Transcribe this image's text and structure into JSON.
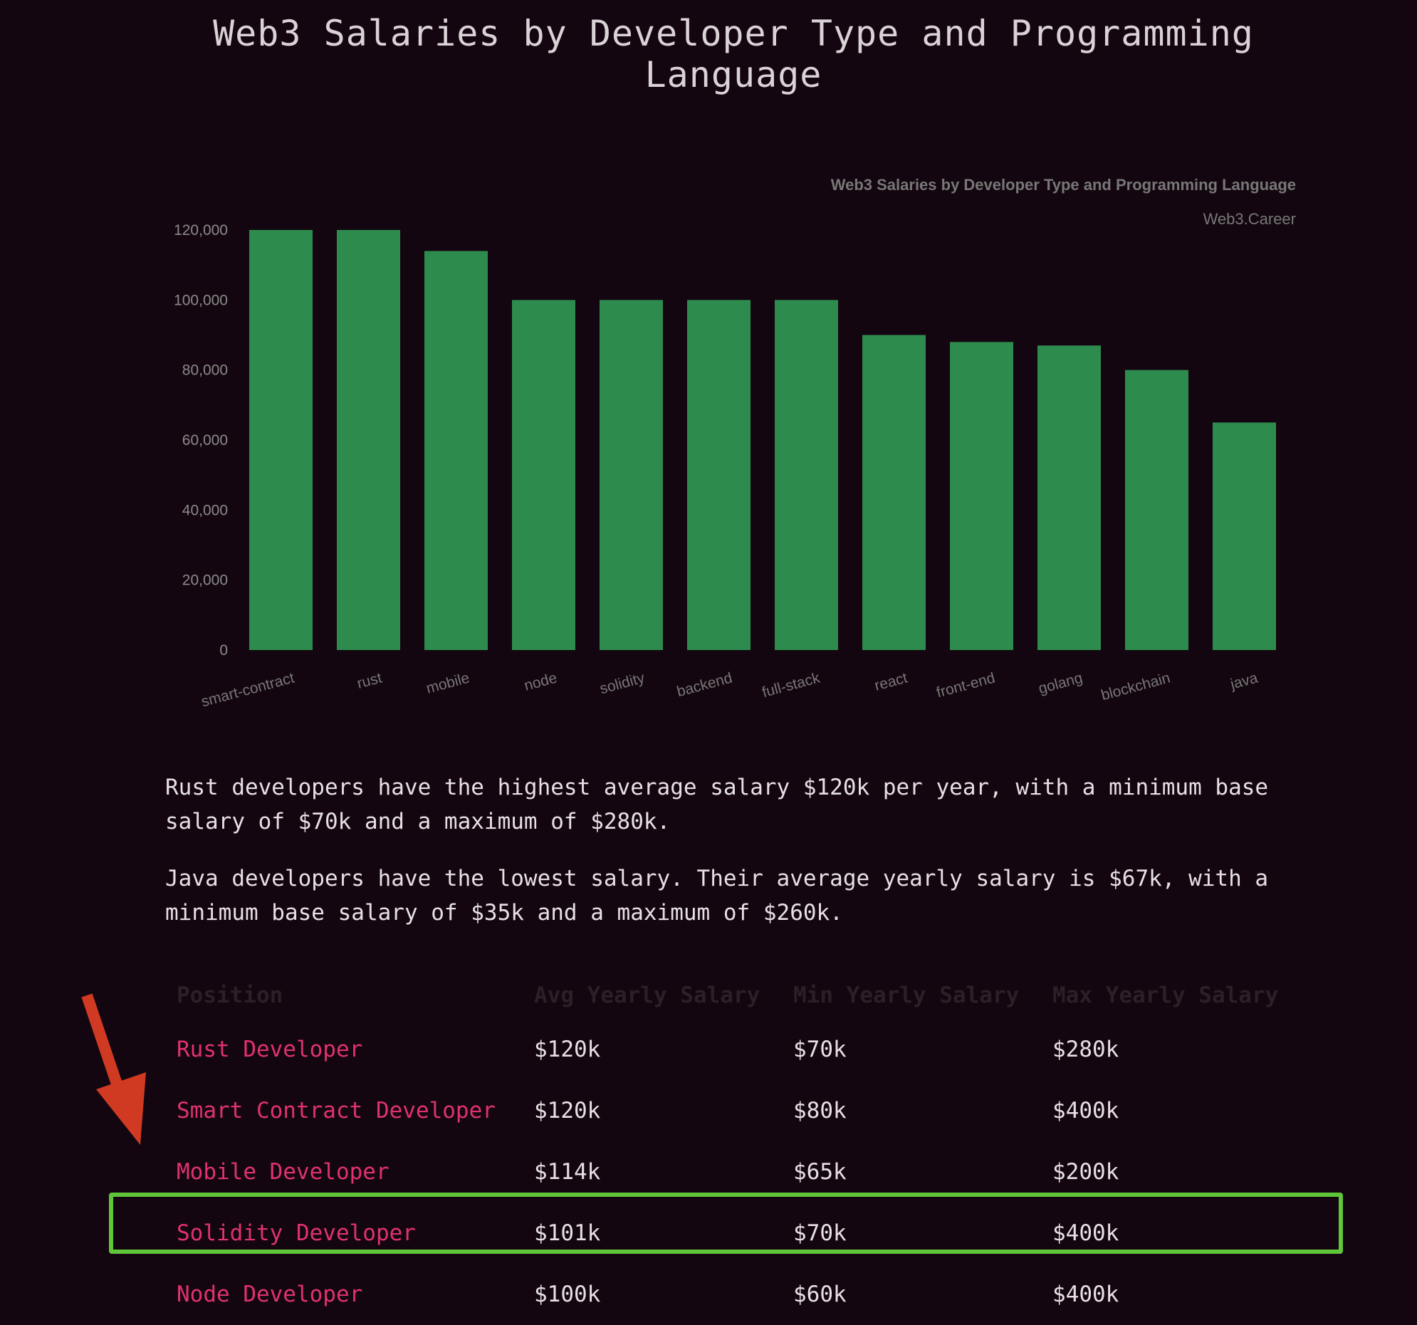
{
  "page": {
    "title": "Web3 Salaries by Developer Type and Programming Language",
    "paragraphs": [
      "Rust developers have the highest average salary $120k per year, with a minimum base salary of $70k and a maximum of $280k.",
      "Java developers have the lowest salary. Their average yearly salary is $67k, with a minimum base salary of $35k and a maximum of $260k."
    ]
  },
  "chart_data": {
    "type": "bar",
    "title": "Web3 Salaries by Developer Type and Programming Language",
    "subtitle": "Web3.Career",
    "categories": [
      "smart-contract",
      "rust",
      "mobile",
      "node",
      "solidity",
      "backend",
      "full-stack",
      "react",
      "front-end",
      "golang",
      "blockchain",
      "java"
    ],
    "values": [
      120000,
      120000,
      114000,
      100000,
      100000,
      100000,
      100000,
      90000,
      88000,
      87000,
      80000,
      65000
    ],
    "ylim": [
      0,
      120000
    ],
    "yticks": [
      0,
      20000,
      40000,
      60000,
      80000,
      100000,
      120000
    ],
    "ytick_labels": [
      "0",
      "20,000",
      "40,000",
      "60,000",
      "80,000",
      "100,000",
      "120,000"
    ],
    "xlabel": "",
    "ylabel": "",
    "bar_color": "#2e8b4e",
    "grid": false,
    "legend": "none"
  },
  "table": {
    "headers": [
      "Position",
      "Avg Yearly Salary",
      "Min Yearly Salary",
      "Max Yearly Salary"
    ],
    "rows": [
      [
        "Rust Developer",
        "$120k",
        "$70k",
        "$280k"
      ],
      [
        "Smart Contract Developer",
        "$120k",
        "$80k",
        "$400k"
      ],
      [
        "Mobile Developer",
        "$114k",
        "$65k",
        "$200k"
      ],
      [
        "Solidity Developer",
        "$101k",
        "$70k",
        "$400k"
      ],
      [
        "Node Developer",
        "$100k",
        "$60k",
        "$400k"
      ]
    ]
  },
  "annotations": {
    "highlight_color": "#5fc63a",
    "arrow_color": "#d03a22",
    "highlighted_row": "Solidity Developer"
  }
}
